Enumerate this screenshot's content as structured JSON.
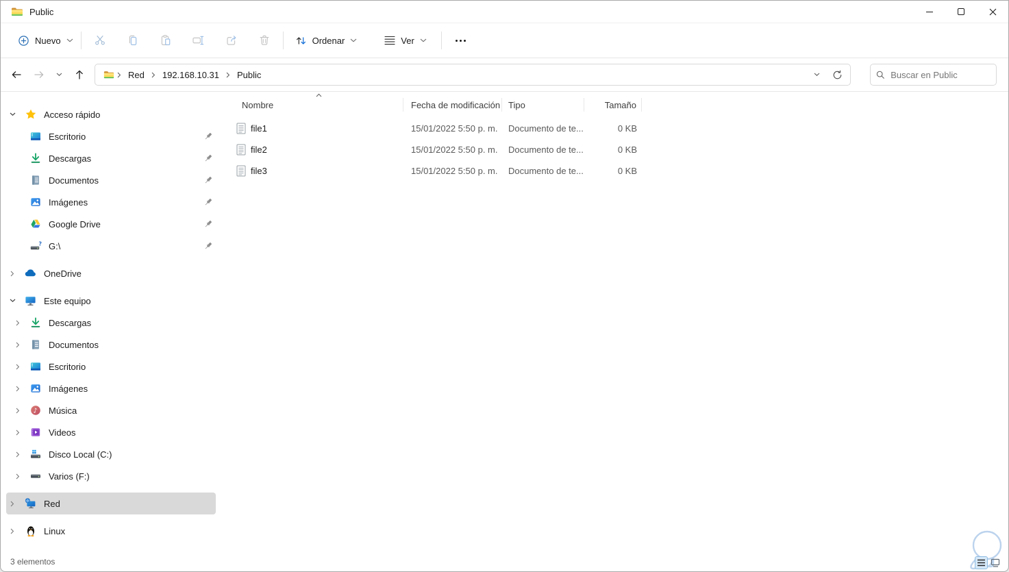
{
  "window": {
    "title": "Public"
  },
  "toolbar": {
    "new_label": "Nuevo",
    "sort_label": "Ordenar",
    "view_label": "Ver",
    "actions": [
      "cut",
      "copy",
      "paste",
      "rename",
      "share",
      "delete"
    ]
  },
  "addressbar": {
    "breadcrumbs": [
      "Red",
      "192.168.10.31",
      "Public"
    ],
    "search_placeholder": "Buscar en Public"
  },
  "sidebar": {
    "quick_access": {
      "label": "Acceso rápido",
      "items": [
        {
          "label": "Escritorio"
        },
        {
          "label": "Descargas"
        },
        {
          "label": "Documentos"
        },
        {
          "label": "Imágenes"
        },
        {
          "label": "Google Drive"
        },
        {
          "label": "G:\\"
        }
      ]
    },
    "onedrive": {
      "label": "OneDrive"
    },
    "this_pc": {
      "label": "Este equipo",
      "items": [
        {
          "label": "Descargas"
        },
        {
          "label": "Documentos"
        },
        {
          "label": "Escritorio"
        },
        {
          "label": "Imágenes"
        },
        {
          "label": "Música"
        },
        {
          "label": "Videos"
        },
        {
          "label": "Disco Local (C:)"
        },
        {
          "label": "Varios (F:)"
        }
      ]
    },
    "network": {
      "label": "Red"
    },
    "linux": {
      "label": "Linux"
    }
  },
  "files": {
    "columns": {
      "name": "Nombre",
      "modified": "Fecha de modificación",
      "type": "Tipo",
      "size": "Tamaño"
    },
    "rows": [
      {
        "name": "file1",
        "modified": "15/01/2022 5:50 p. m.",
        "type": "Documento de te...",
        "size": "0 KB"
      },
      {
        "name": "file2",
        "modified": "15/01/2022 5:50 p. m.",
        "type": "Documento de te...",
        "size": "0 KB"
      },
      {
        "name": "file3",
        "modified": "15/01/2022 5:50 p. m.",
        "type": "Documento de te...",
        "size": "0 KB"
      }
    ]
  },
  "statusbar": {
    "items_count": "3 elementos"
  },
  "colors": {
    "accent_blue": "#0b6ad6",
    "selection_gray": "#d9d9d9",
    "folder_yellow": "#fcd24f",
    "folder_green": "#43b14b"
  },
  "icons": [
    "folder-icon",
    "minimize-icon",
    "maximize-icon",
    "close-icon",
    "new-plus-icon",
    "cut-icon",
    "copy-icon",
    "paste-icon",
    "rename-icon",
    "share-icon",
    "delete-icon",
    "sort-icon",
    "view-icon",
    "more-options-icon",
    "back-icon",
    "forward-icon",
    "recent-locations-icon",
    "up-icon",
    "refresh-icon",
    "search-icon",
    "star-icon",
    "desktop-icon",
    "downloads-icon",
    "documents-icon",
    "pictures-icon",
    "google-drive-icon",
    "drive-question-icon",
    "onedrive-icon",
    "this-pc-icon",
    "music-icon",
    "videos-icon",
    "local-disk-icon",
    "drive-icon",
    "network-icon",
    "linux-icon",
    "pin-icon",
    "text-document-icon",
    "details-view-icon",
    "large-icons-view-icon",
    "bulb-watermark"
  ]
}
